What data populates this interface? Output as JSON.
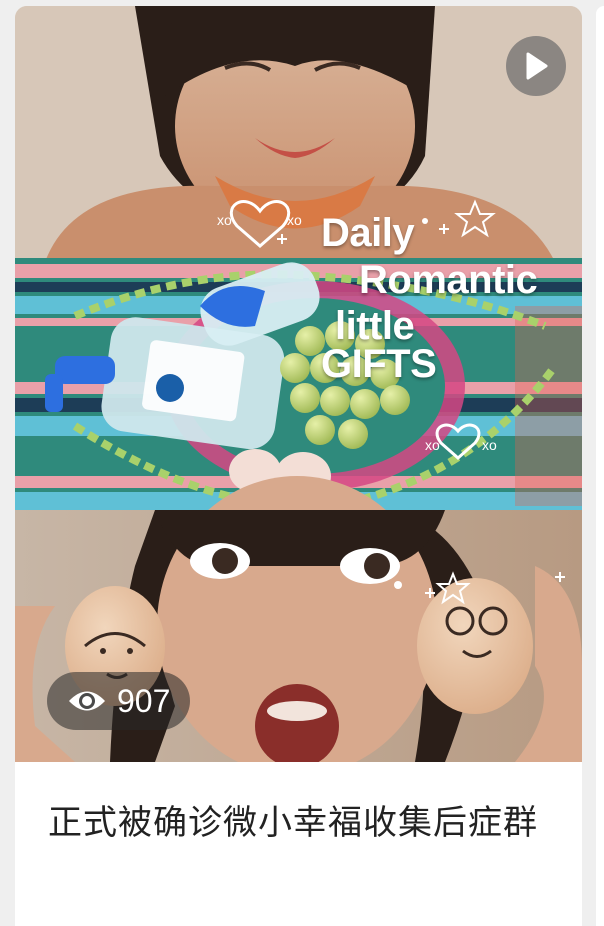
{
  "cover": {
    "overlay_lines": [
      "Daily",
      "Romantic",
      "little",
      "GIFTS"
    ],
    "overlay_marks": {
      "xo": "xo"
    }
  },
  "play_icon": "play-icon",
  "views": {
    "icon": "eye-icon",
    "count": "907"
  },
  "title": "正式被确诊微小幸福收集后症群",
  "colors": {
    "badge_bg": "rgba(40,40,40,0.55)",
    "title_text": "#222222",
    "page_bg": "#efefef"
  }
}
